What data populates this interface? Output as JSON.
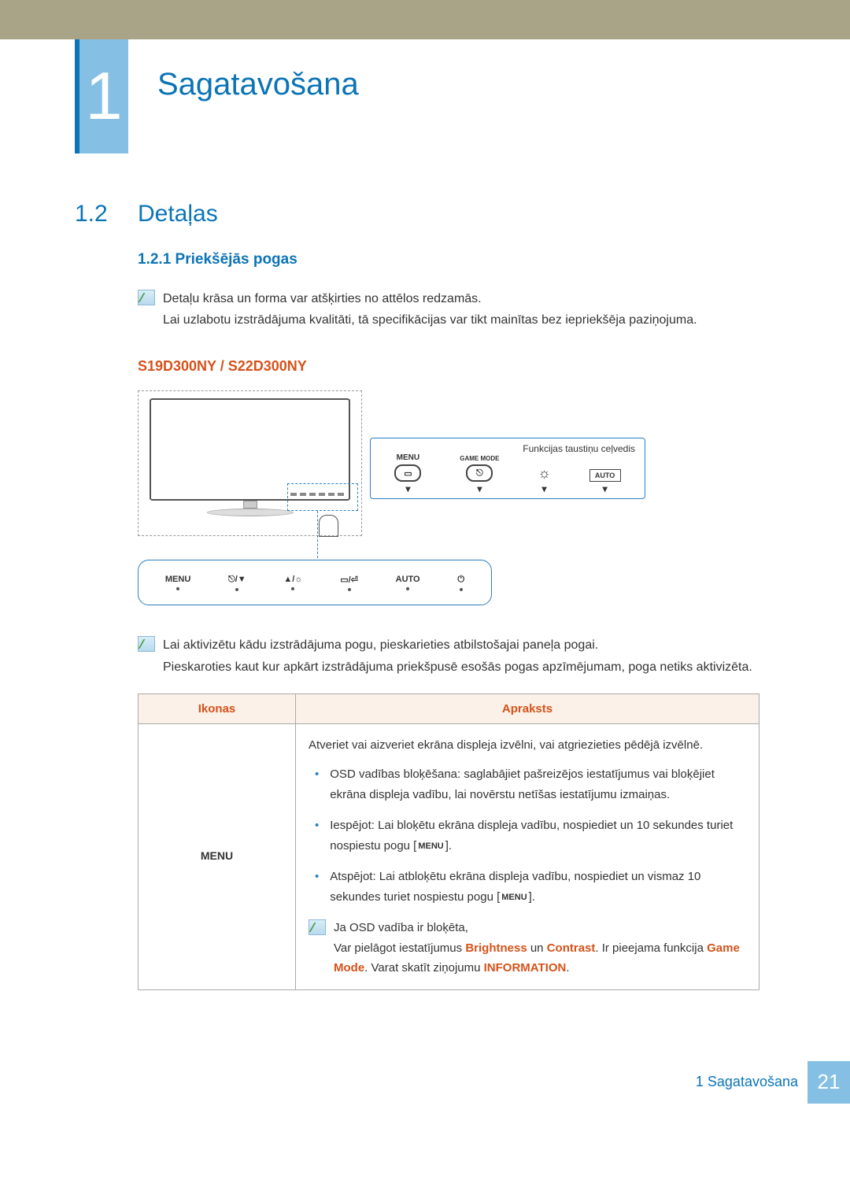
{
  "header": {
    "chapter_number": "1",
    "chapter_title": "Sagatavošana"
  },
  "section": {
    "number": "1.2",
    "title": "Detaļas"
  },
  "subsection": {
    "number_title": "1.2.1 Priekšējās pogas"
  },
  "note1_line1": "Detaļu krāsa un forma var atšķirties no attēlos redzamās.",
  "note1_line2": "Lai uzlabotu izstrādājuma kvalitāti, tā specifikācijas var tikt mainītas bez iepriekšēja paziņojuma.",
  "models": "S19D300NY / S22D300NY",
  "diagram": {
    "guide_title": "Funkcijas taustiņu ceļvedis",
    "cols": {
      "menu": "MENU",
      "game": "GAME MODE",
      "auto": "AUTO"
    },
    "bottom": {
      "menu": "MENU",
      "auto": "AUTO"
    }
  },
  "note2_line1": "Lai aktivizētu kādu izstrādājuma pogu, pieskarieties atbilstošajai paneļa pogai.",
  "note2_line2": "Pieskaroties kaut kur apkārt izstrādājuma priekšpusē esošās pogas apzīmējumam, poga netiks aktivizēta.",
  "table": {
    "head_icons": "Ikonas",
    "head_desc": "Apraksts",
    "row1": {
      "icon_label": "MENU",
      "p1": "Atveriet vai aizveriet ekrāna displeja izvēlni, vai atgriezieties pēdējā izvēlnē.",
      "b1": "OSD vadības bloķēšana: saglabājiet pašreizējos iestatījumus vai bloķējiet ekrāna displeja vadību, lai novērstu netīšas iestatījumu izmaiņas.",
      "b2_a": "Iespējot: Lai bloķētu ekrāna displeja vadību, nospiediet un 10 sekundes turiet nospiestu pogu [",
      "b2_menu": "MENU",
      "b2_b": "].",
      "b3_a": "Atspējot: Lai atbloķētu ekrāna displeja vadību, nospiediet un vismaz 10 sekundes turiet nospiestu pogu [",
      "b3_menu": "MENU",
      "b3_b": "].",
      "note_a": "Ja OSD vadība ir bloķēta,",
      "note_b1": "Var pielāgot iestatījumus ",
      "note_brightness": "Brightness",
      "note_b2": " un ",
      "note_contrast": "Contrast",
      "note_b3": ". Ir pieejama funkcija ",
      "note_game": "Game Mode",
      "note_b4": ". Varat skatīt ziņojumu ",
      "note_info": "INFORMATION",
      "note_b5": "."
    }
  },
  "footer": {
    "label": "1 Sagatavošana",
    "page": "21"
  }
}
